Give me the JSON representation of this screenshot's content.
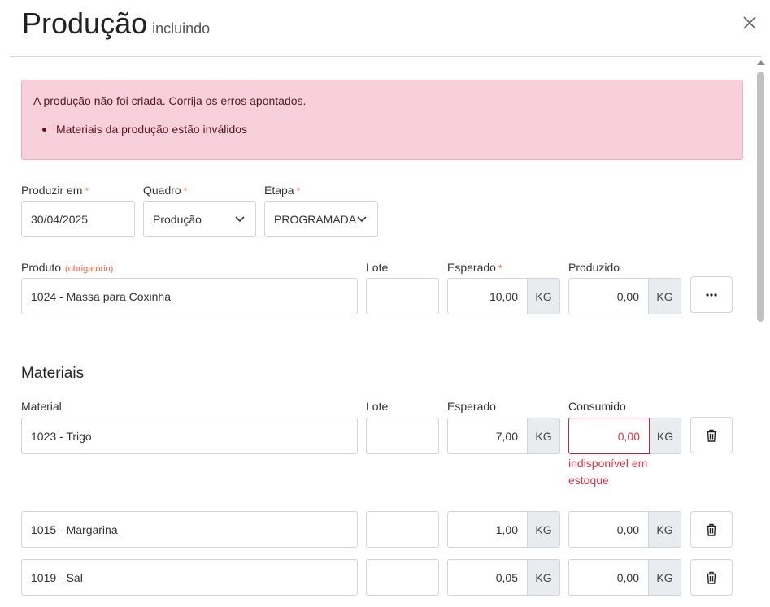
{
  "header": {
    "title": "Produção",
    "subtitle": "incluindo"
  },
  "alert": {
    "message": "A produção não foi criada. Corrija os erros apontados.",
    "items": [
      "Materiais da produção estão inválidos"
    ]
  },
  "form": {
    "produzir_em": {
      "label": "Produzir em",
      "required": "*",
      "value": "30/04/2025"
    },
    "quadro": {
      "label": "Quadro",
      "required": "*",
      "value": "Produção"
    },
    "etapa": {
      "label": "Etapa",
      "required": "*",
      "value": "PROGRAMADA"
    },
    "produto": {
      "label": "Produto",
      "note": "(obrigatório)",
      "value": "1024 - Massa para Coxinha"
    },
    "lote": {
      "label": "Lote",
      "value": ""
    },
    "esperado": {
      "label": "Esperado",
      "required": "*",
      "value": "10,00",
      "unit": "KG"
    },
    "produzido": {
      "label": "Produzido",
      "value": "0,00",
      "unit": "KG"
    },
    "more_label": "···"
  },
  "materiais": {
    "title": "Materiais",
    "headers": {
      "material": "Material",
      "lote": "Lote",
      "esperado": "Esperado",
      "consumido": "Consumido"
    },
    "rows": [
      {
        "material": "1023 - Trigo",
        "lote": "",
        "esperado": "7,00",
        "esperado_unit": "KG",
        "consumido": "0,00",
        "consumido_unit": "KG",
        "error": "indisponível em estoque"
      },
      {
        "material": "1015 - Margarina",
        "lote": "",
        "esperado": "1,00",
        "esperado_unit": "KG",
        "consumido": "0,00",
        "consumido_unit": "KG",
        "error": ""
      },
      {
        "material": "1019 - Sal",
        "lote": "",
        "esperado": "0,05",
        "esperado_unit": "KG",
        "consumido": "0,00",
        "consumido_unit": "KG",
        "error": ""
      }
    ]
  },
  "icons": {
    "close": "close-icon",
    "chevron": "chevron-down-icon",
    "trash": "trash-icon",
    "more": "ellipsis-icon"
  },
  "colors": {
    "alert_bg": "#f8d0dc",
    "error": "#dc3545",
    "required": "#e4664a"
  }
}
